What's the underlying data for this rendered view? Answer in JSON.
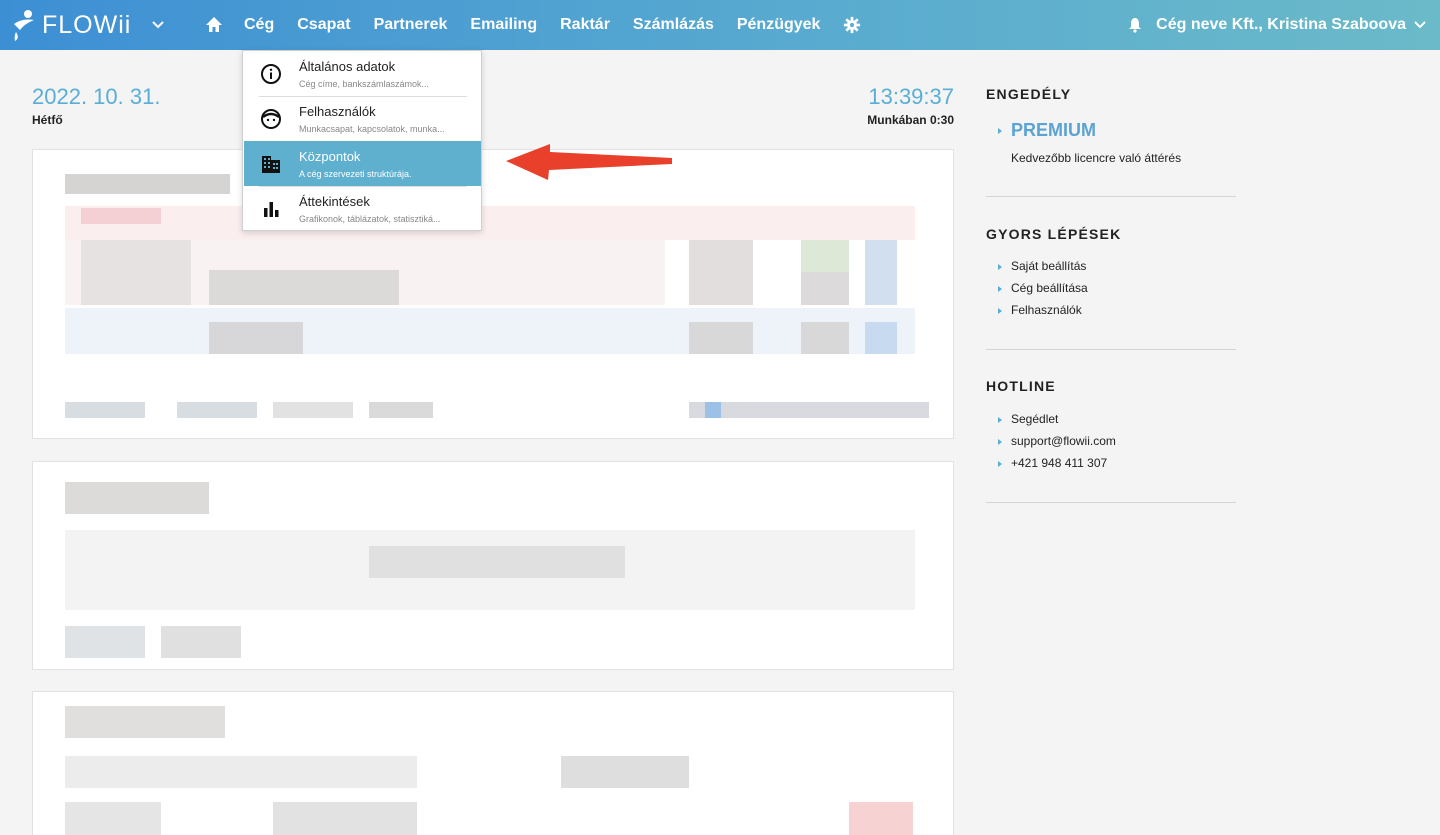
{
  "app": {
    "logo_text": "FLOWii"
  },
  "nav": {
    "items": [
      "Cég",
      "Csapat",
      "Partnerek",
      "Emailing",
      "Raktár",
      "Számlázás",
      "Pénzügyek"
    ],
    "user_label": "Cég neve Kft., Kristina Szaboova"
  },
  "header": {
    "date": "2022. 10. 31.",
    "day": "Hétfő",
    "time": "13:39:37",
    "work": "Munkában 0:30"
  },
  "dropdown": {
    "items": [
      {
        "title": "Általános adatok",
        "sub": "Cég címe, bankszámlaszámok...",
        "icon": "info-icon"
      },
      {
        "title": "Felhasználók",
        "sub": "Munkacsapat, kapcsolatok, munka...",
        "icon": "face-icon"
      },
      {
        "title": "Központok",
        "sub": "A cég szervezeti struktúrája.",
        "icon": "building-icon",
        "active": true
      },
      {
        "title": "Áttekintések",
        "sub": "Grafikonok, táblázatok, statisztiká...",
        "icon": "bar-chart-icon"
      }
    ]
  },
  "sidebar": {
    "license": {
      "heading": "ENGEDÉLY",
      "plan": "PREMIUM",
      "desc": "Kedvezőbb licencre való áttérés"
    },
    "quick": {
      "heading": "GYORS LÉPÉSEK",
      "links": [
        "Saját beállítás",
        "Cég beállítása",
        "Felhasználók"
      ]
    },
    "hotline": {
      "heading": "HOTLINE",
      "links": [
        "Segédlet",
        "support@flowii.com",
        "+421 948 411 307"
      ]
    }
  },
  "colors": {
    "nav_start": "#3d8fd4",
    "nav_end": "#6bbac9",
    "accent": "#5aaed6",
    "active_item": "#5fb0cf",
    "arrow": "#e8402a"
  }
}
